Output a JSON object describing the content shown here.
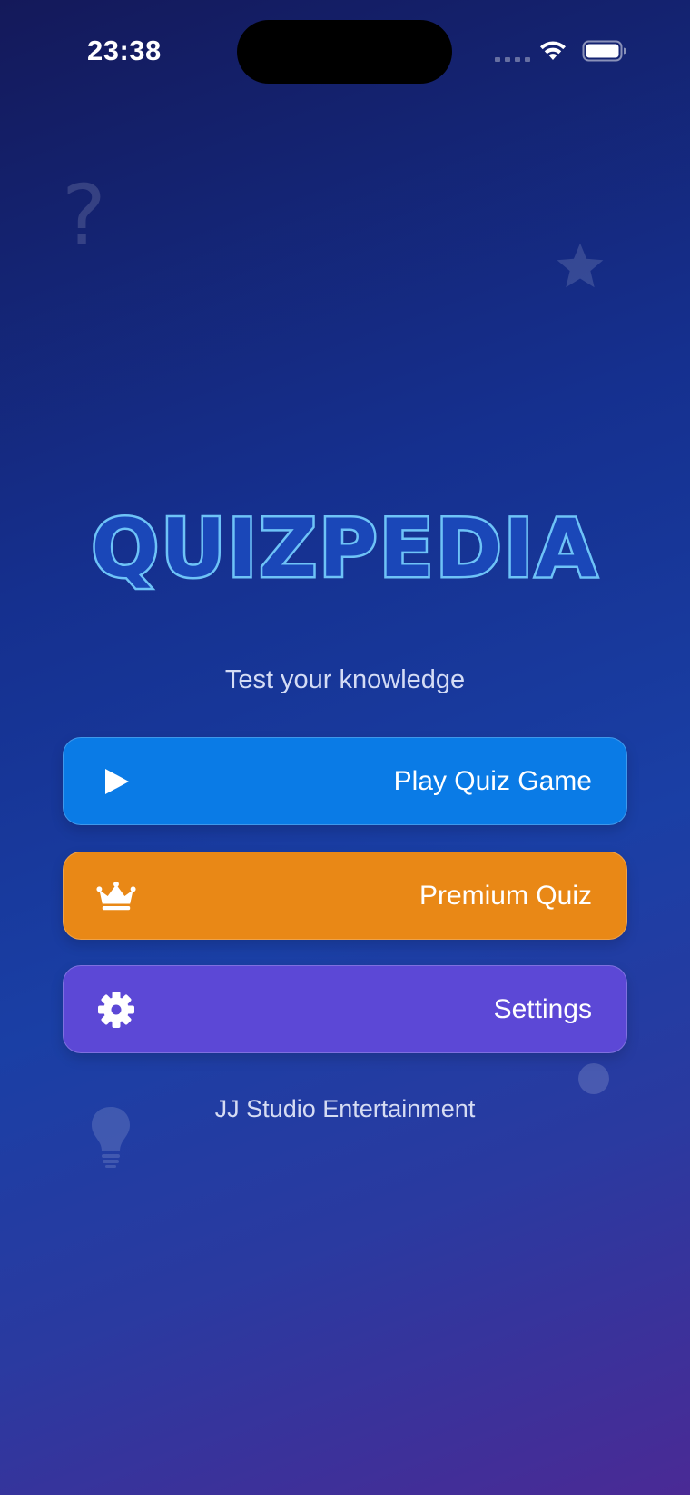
{
  "status_bar": {
    "time": "23:38"
  },
  "app": {
    "logo_text": "QUIZPEDIA",
    "tagline": "Test your knowledge",
    "footer": "JJ Studio Entertainment"
  },
  "menu": {
    "play": {
      "label": "Play Quiz Game",
      "icon": "play-icon",
      "color": "#0a7be6"
    },
    "premium": {
      "label": "Premium Quiz",
      "icon": "crown-icon",
      "color": "#e98816"
    },
    "settings": {
      "label": "Settings",
      "icon": "gear-icon",
      "color": "#5c48d6"
    }
  },
  "colors": {
    "logo": "#6ec3f7",
    "background_top": "#14195a",
    "background_bottom": "#4a2a95"
  }
}
